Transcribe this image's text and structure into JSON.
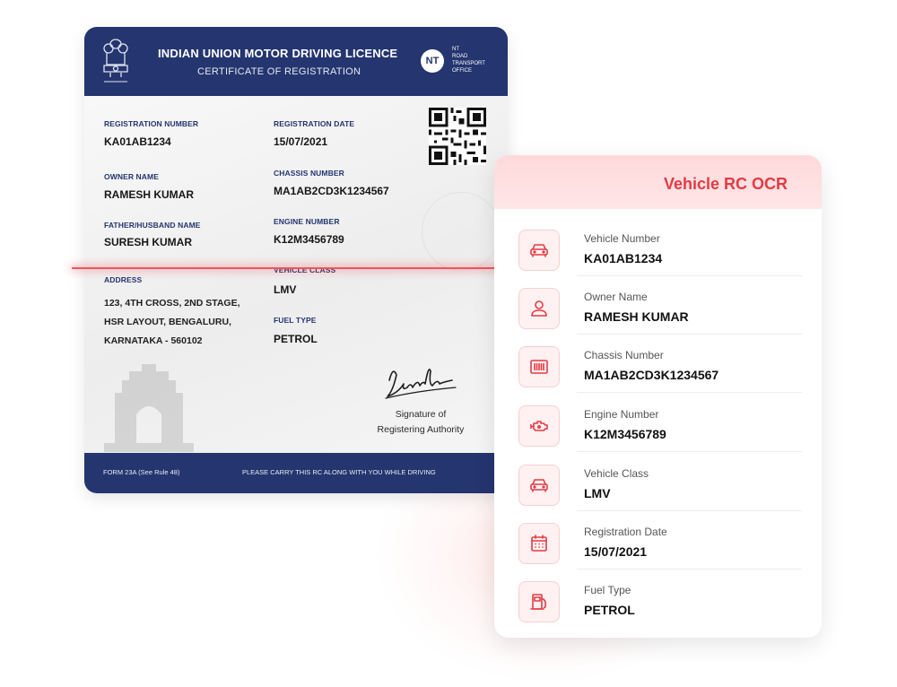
{
  "rc_card": {
    "title": "INDIAN UNION MOTOR DRIVING LICENCE",
    "subtitle": "CERTIFICATE OF REGISTRATION",
    "badge": "NT",
    "badge_text": "NT\nROAD\nTRANSPORT\nOFFICE",
    "fields": {
      "registration_number": {
        "label": "REGISTRATION NUMBER",
        "value": "KA01AB1234"
      },
      "registration_date": {
        "label": "REGISTRATION DATE",
        "value": "15/07/2021"
      },
      "owner_name": {
        "label": "OWNER NAME",
        "value": "RAMESH KUMAR"
      },
      "chassis_number": {
        "label": "CHASSIS NUMBER",
        "value": "MA1AB2CD3K1234567"
      },
      "father_name": {
        "label": "FATHER/HUSBAND NAME",
        "value": "SURESH KUMAR"
      },
      "engine_number": {
        "label": "ENGINE NUMBER",
        "value": "K12M3456789"
      },
      "address": {
        "label": "ADDRESS",
        "line1": "123, 4TH CROSS, 2ND STAGE,",
        "line2": "HSR LAYOUT, BENGALURU,",
        "line3": "KARNATAKA - 560102"
      },
      "vehicle_class": {
        "label": "VEHICLE CLASS",
        "value": "LMV"
      },
      "fuel_type": {
        "label": "FUEL TYPE",
        "value": "PETROL"
      }
    },
    "signature_caption_line1": "Signature of",
    "signature_caption_line2": "Registering Authority",
    "footer_left": "FORM 23A (See Rule 48)",
    "footer_right": "PLEASE CARRY THIS RC ALONG WITH YOU WHILE DRIVING"
  },
  "ocr_panel": {
    "title": "Vehicle RC OCR",
    "items": [
      {
        "label": "Vehicle Number",
        "value": "KA01AB1234",
        "icon": "car-icon"
      },
      {
        "label": "Owner Name",
        "value": "RAMESH KUMAR",
        "icon": "user-icon"
      },
      {
        "label": "Chassis Number",
        "value": "MA1AB2CD3K1234567",
        "icon": "barcode-icon"
      },
      {
        "label": "Engine Number",
        "value": "K12M3456789",
        "icon": "engine-icon"
      },
      {
        "label": "Vehicle Class",
        "value": "LMV",
        "icon": "car-icon"
      },
      {
        "label": "Registration Date",
        "value": "15/07/2021",
        "icon": "calendar-icon"
      },
      {
        "label": "Fuel Type",
        "value": "PETROL",
        "icon": "fuel-pump-icon"
      }
    ]
  },
  "colors": {
    "navy": "#24356f",
    "accent_red": "#e23b44",
    "scan_line": "#f0545b",
    "icon_bg": "#fff1f1"
  }
}
